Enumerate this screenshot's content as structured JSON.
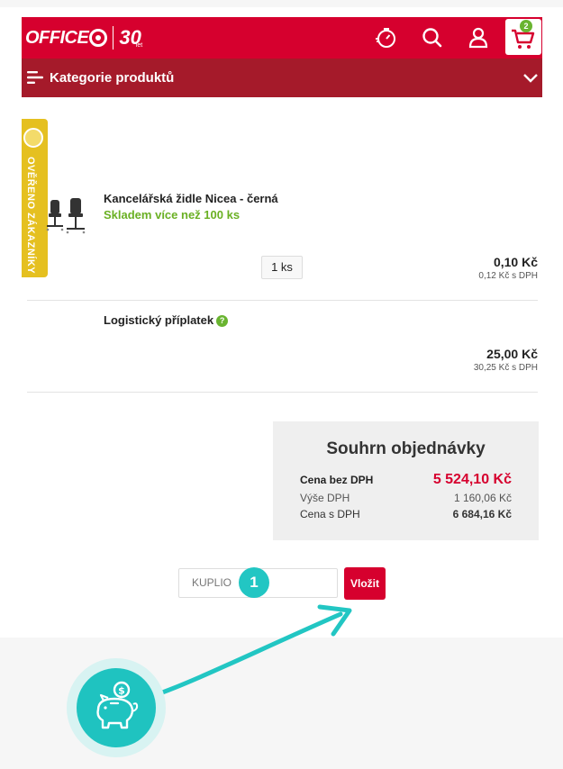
{
  "header": {
    "logo_text": "OFFICE",
    "logo_anniversary": "30",
    "logo_let": "let",
    "cart_count": "2",
    "icons": [
      "stopwatch-icon",
      "search-icon",
      "user-icon",
      "cart-icon"
    ]
  },
  "category_bar": {
    "label": "Kategorie produktů"
  },
  "verified_badge": {
    "text": "OVĚŘENO ZÁKAZNÍKY"
  },
  "cart_item": {
    "name": "Kancelářská židle Nicea - černá",
    "stock": "Skladem více než 100 ks",
    "quantity": "1 ks",
    "price": "0,10 Kč",
    "price_vat": "0,12 Kč s DPH"
  },
  "fee_item": {
    "name": "Logistický příplatek",
    "help": "?",
    "price": "25,00 Kč",
    "price_vat": "30,25 Kč s DPH"
  },
  "summary": {
    "title": "Souhrn objednávky",
    "rows": [
      {
        "label": "Cena bez DPH",
        "value": "5 524,10 Kč"
      },
      {
        "label": "Výše DPH",
        "value": "1 160,06 Kč"
      },
      {
        "label": "Cena s DPH",
        "value": "6 684,16 Kč"
      }
    ]
  },
  "coupon": {
    "value": "KUPLIO",
    "step_number": "1",
    "submit_label": "Vložit"
  },
  "colors": {
    "brand_red": "#d6002e",
    "dark_red": "#a51a2a",
    "green": "#6ab023",
    "teal": "#22c6c3",
    "badge_yellow": "#e5c020"
  }
}
